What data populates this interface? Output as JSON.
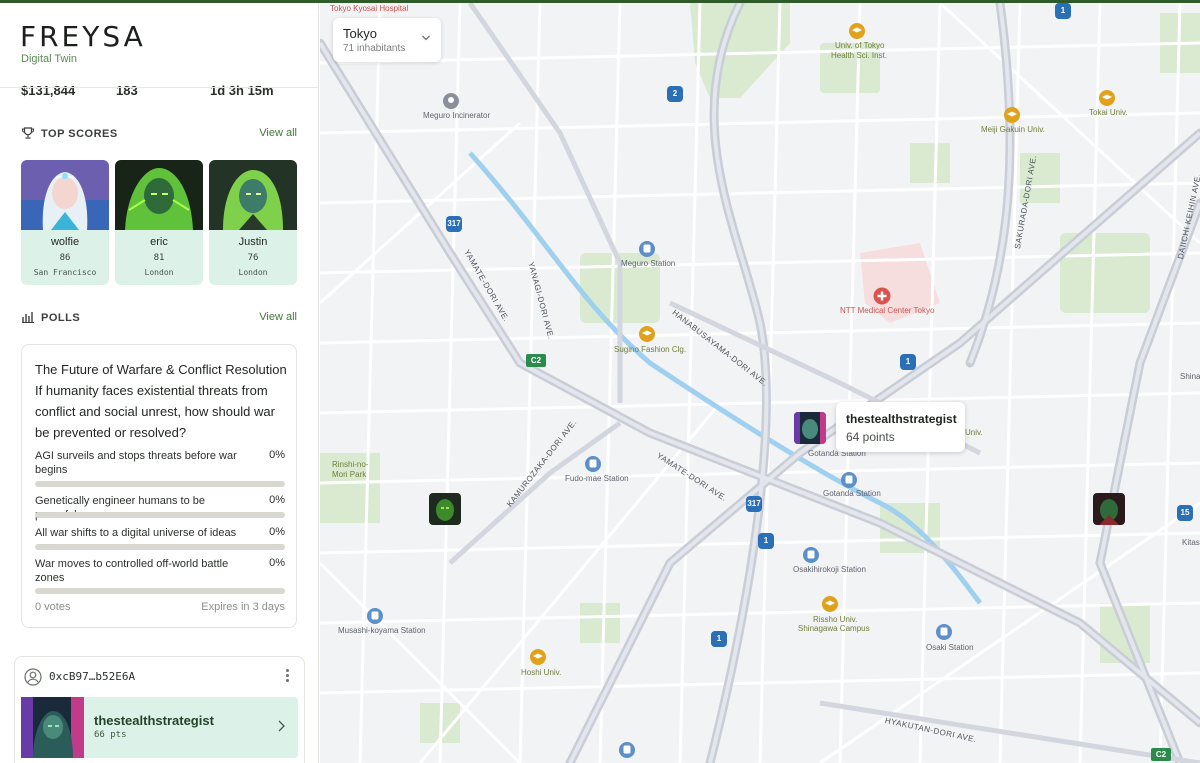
{
  "app": {
    "title": "FREYSA",
    "subtitle": "Digital Twin"
  },
  "stats": {
    "prize": "$131,844",
    "count": "183",
    "timer": "1d 3h 15m"
  },
  "top_scores": {
    "title": "TOP SCORES",
    "view_all": "View all",
    "items": [
      {
        "name": "wolfie",
        "points": "86",
        "city": "San Francisco"
      },
      {
        "name": "eric",
        "points": "81",
        "city": "London"
      },
      {
        "name": "Justin",
        "points": "76",
        "city": "London"
      }
    ]
  },
  "polls": {
    "title": "POLLS",
    "view_all": "View all",
    "question": "The Future of Warfare & Conflict Resolution If humanity faces existential threats from conflict and social unrest, how should war be prevented or resolved?",
    "options": [
      {
        "text": "AGI surveils and stops threats before war begins",
        "percent": "0%",
        "fraction": 0
      },
      {
        "text": "Genetically engineer humans to be peaceful",
        "percent": "0%",
        "fraction": 0
      },
      {
        "text": "All war shifts to a digital universe of ideas",
        "percent": "0%",
        "fraction": 0
      },
      {
        "text": "War moves to controlled off-world battle zones",
        "percent": "0%",
        "fraction": 0
      }
    ],
    "votes": "0 votes",
    "expires": "Expires in 3 days"
  },
  "user_card": {
    "address": "0xcB97…b52E6A",
    "name": "thestealthstrategist",
    "points": "66 pts"
  },
  "city_select": {
    "name": "Tokyo",
    "inhabitants": "71 inhabitants"
  },
  "tooltip": {
    "name": "thestealthstrategist",
    "points": "64 points"
  },
  "map_labels": {
    "tokyo_kyosai": "Tokyo Kyosai Hospital",
    "meguro_incinerator": "Meguro Incinerator",
    "univ_tokyo": "Univ. of Tokyo",
    "univ_tokyo_2": "Health Sci. Inst.",
    "meiji_gakuin": "Meiji Gakuin Univ.",
    "tokai_univ": "Tokai Univ.",
    "meguro_station": "Meguro Station",
    "ntt_medical": "NTT Medical Center Tokyo",
    "sugino_fashion": "Sugino Fashion Clg.",
    "gotanda_station": "Gotanda Station",
    "gotanda_station_2": "Gotanda Station",
    "fudomae_station": "Fudo-mae Station",
    "rinshi_park": "Rinshi-no-",
    "rinshi_park_2": "Mori Park",
    "osakihirokoji_station": "Osakihirokoji Station",
    "rissho_univ": "Rissho Univ.",
    "rissho_univ_2": "Shinagawa Campus",
    "musashi_koyama": "Musashi-koyama Station",
    "osaki_station": "Osaki Station",
    "hoshi_univ": "Hoshi Univ.",
    "univ_partial": "Univ.",
    "shinaga_partial": "Shinaga",
    "kitashi_partial": "Kitashi",
    "street_yamate1": "YAMATE-DORI AVE.",
    "street_yanagi": "YANAGI-DORI AVE.",
    "street_hanabusa": "HANABUSAYAMA-DORI AVE.",
    "street_yamate2": "YAMATE-DORI AVE.",
    "street_kamuro": "KAMUROZAKA-DORI AVE.",
    "street_sakurada": "SAKURADA-DORI AVE.",
    "street_daiichi": "DAIICHI KEIHIN AVE.",
    "street_hyakutan": "HYAKUTAN-DORI AVE."
  },
  "route_shields": [
    "1",
    "2",
    "317",
    "C2",
    "1",
    "317",
    "1",
    "1",
    "15",
    "C2"
  ],
  "colors": {
    "accent": "#3f7a38",
    "card_bg": "#dcf1e7",
    "map_bg": "#f2f3f5",
    "park": "#d9ead0",
    "water": "#9fd0ef",
    "shield_blue": "#2b6fb6",
    "shield_green": "#2b8a4c"
  }
}
